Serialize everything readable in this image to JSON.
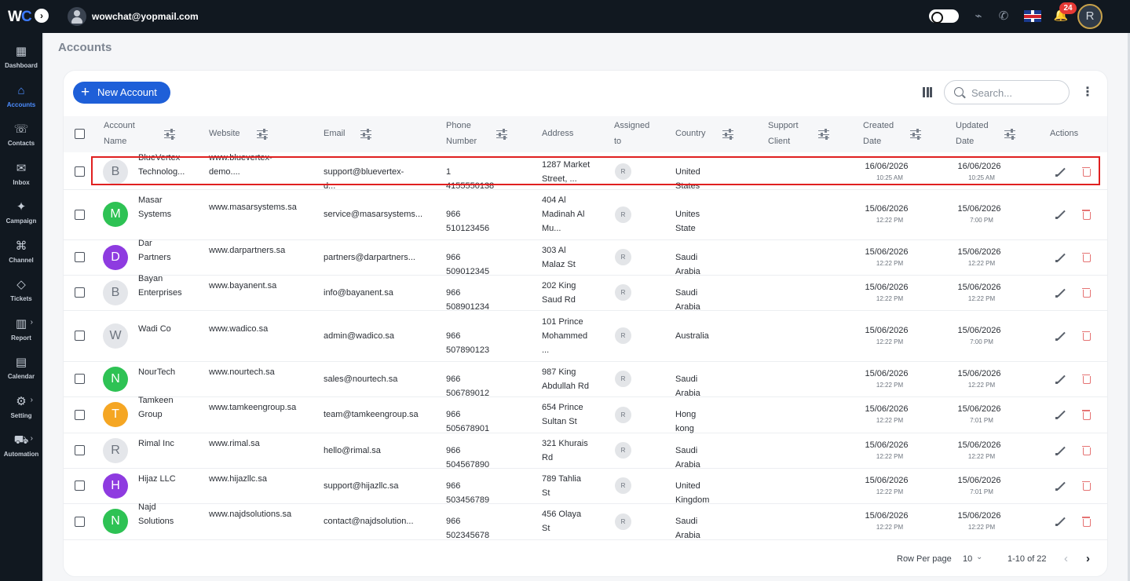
{
  "app": {
    "logo_text": "WC",
    "user_email": "wowchat@yopmail.com",
    "notification_count": "24",
    "user_initial": "R"
  },
  "sidebar": {
    "items": [
      {
        "label": "Dashboard",
        "icon": "dashboard-icon"
      },
      {
        "label": "Accounts",
        "icon": "home-icon",
        "active": true
      },
      {
        "label": "Contacts",
        "icon": "contacts-icon"
      },
      {
        "label": "Inbox",
        "icon": "inbox-icon"
      },
      {
        "label": "Campaign",
        "icon": "campaign-icon"
      },
      {
        "label": "Channel",
        "icon": "channel-icon"
      },
      {
        "label": "Tickets",
        "icon": "ticket-icon"
      },
      {
        "label": "Report",
        "icon": "report-icon"
      },
      {
        "label": "Calendar",
        "icon": "calendar-icon"
      },
      {
        "label": "Setting",
        "icon": "gear-icon"
      },
      {
        "label": "Automation",
        "icon": "automation-icon"
      }
    ]
  },
  "page": {
    "title": "Accounts",
    "new_button": "New Account",
    "search_placeholder": "Search..."
  },
  "table": {
    "headers": {
      "account_name_1": "Account",
      "account_name_2": "Name",
      "website": "Website",
      "email": "Email",
      "phone_1": "Phone",
      "phone_2": "Number",
      "address": "Address",
      "assigned_1": "Assigned",
      "assigned_2": "to",
      "country": "Country",
      "support_1": "Support",
      "support_2": "Client",
      "created_1": "Created",
      "created_2": "Date",
      "updated_1": "Updated",
      "updated_2": "Date",
      "actions": "Actions"
    },
    "rows": [
      {
        "initial": "B",
        "avatar_color": "#e4e6ea",
        "avatar_text_color": "#6d747e",
        "name_1": "BlueVertex",
        "name_2": "Technolog...",
        "website_1": "www.bluevertex-",
        "website_2": "demo....",
        "email": "support@bluevertex-d...",
        "phone": "1 4155550138",
        "address_1": "1287 Market",
        "address_2": "Street, ...",
        "address_3": "",
        "assigned": "R",
        "country": "United States",
        "created_date": "16/06/2026",
        "created_time": "10:25 AM",
        "updated_date": "16/06/2026",
        "updated_time": "10:25 AM"
      },
      {
        "initial": "M",
        "avatar_color": "#2ec254",
        "avatar_text_color": "#ffffff",
        "name_1": "Masar",
        "name_2": "Systems",
        "website_1": "www.masarsystems.sa",
        "website_2": "",
        "email": "service@masarsystems...",
        "phone": "966 510123456",
        "address_1": "404 Al",
        "address_2": "Madinah Al",
        "address_3": "Mu...",
        "assigned": "R",
        "country": "Unites State",
        "created_date": "15/06/2026",
        "created_time": "12:22 PM",
        "updated_date": "15/06/2026",
        "updated_time": "7:00 PM"
      },
      {
        "initial": "D",
        "avatar_color": "#8e3be0",
        "avatar_text_color": "#ffffff",
        "name_1": "Dar",
        "name_2": "Partners",
        "website_1": "www.darpartners.sa",
        "website_2": "",
        "email": "partners@darpartners...",
        "phone": "966 509012345",
        "address_1": "303 Al",
        "address_2": "Malaz St",
        "address_3": "",
        "assigned": "R",
        "country": "Saudi Arabia",
        "created_date": "15/06/2026",
        "created_time": "12:22 PM",
        "updated_date": "15/06/2026",
        "updated_time": "12:22 PM"
      },
      {
        "initial": "B",
        "avatar_color": "#e4e6ea",
        "avatar_text_color": "#6d747e",
        "name_1": "Bayan",
        "name_2": "Enterprises",
        "website_1": "www.bayanent.sa",
        "website_2": "",
        "email": "info@bayanent.sa",
        "phone": "966 508901234",
        "address_1": "202 King",
        "address_2": "Saud Rd",
        "address_3": "",
        "assigned": "R",
        "country": "Saudi Arabia",
        "created_date": "15/06/2026",
        "created_time": "12:22 PM",
        "updated_date": "15/06/2026",
        "updated_time": "12:22 PM"
      },
      {
        "initial": "W",
        "avatar_color": "#e4e6ea",
        "avatar_text_color": "#6d747e",
        "name_1": "Wadi Co",
        "name_2": "",
        "website_1": "www.wadico.sa",
        "website_2": "",
        "email": "admin@wadico.sa",
        "phone": "966 507890123",
        "address_1": "101 Prince",
        "address_2": "Mohammed",
        "address_3": "...",
        "assigned": "R",
        "country": "Australia",
        "created_date": "15/06/2026",
        "created_time": "12:22 PM",
        "updated_date": "15/06/2026",
        "updated_time": "7:00 PM"
      },
      {
        "initial": "N",
        "avatar_color": "#2ec254",
        "avatar_text_color": "#ffffff",
        "name_1": "NourTech",
        "name_2": "",
        "website_1": "www.nourtech.sa",
        "website_2": "",
        "email": "sales@nourtech.sa",
        "phone": "966 506789012",
        "address_1": "987 King",
        "address_2": "Abdullah Rd",
        "address_3": "",
        "assigned": "R",
        "country": "Saudi Arabia",
        "created_date": "15/06/2026",
        "created_time": "12:22 PM",
        "updated_date": "15/06/2026",
        "updated_time": "12:22 PM"
      },
      {
        "initial": "T",
        "avatar_color": "#f5a623",
        "avatar_text_color": "#ffffff",
        "name_1": "Tamkeen",
        "name_2": "Group",
        "website_1": "www.tamkeengroup.sa",
        "website_2": "",
        "email": "team@tamkeengroup.sa",
        "phone": "966 505678901",
        "address_1": "654 Prince",
        "address_2": "Sultan St",
        "address_3": "",
        "assigned": "R",
        "country": "Hong kong",
        "created_date": "15/06/2026",
        "created_time": "12:22 PM",
        "updated_date": "15/06/2026",
        "updated_time": "7:01 PM"
      },
      {
        "initial": "R",
        "avatar_color": "#e4e6ea",
        "avatar_text_color": "#6d747e",
        "name_1": "Rimal Inc",
        "name_2": "",
        "website_1": "www.rimal.sa",
        "website_2": "",
        "email": "hello@rimal.sa",
        "phone": "966 504567890",
        "address_1": "321 Khurais",
        "address_2": "Rd",
        "address_3": "",
        "assigned": "R",
        "country": "Saudi Arabia",
        "created_date": "15/06/2026",
        "created_time": "12:22 PM",
        "updated_date": "15/06/2026",
        "updated_time": "12:22 PM"
      },
      {
        "initial": "H",
        "avatar_color": "#8e3be0",
        "avatar_text_color": "#ffffff",
        "name_1": "Hijaz LLC",
        "name_2": "",
        "website_1": "www.hijazllc.sa",
        "website_2": "",
        "email": "support@hijazllc.sa",
        "phone": "966 503456789",
        "address_1": "789 Tahlia",
        "address_2": "St",
        "address_3": "",
        "assigned": "R",
        "country": "United Kingdom",
        "created_date": "15/06/2026",
        "created_time": "12:22 PM",
        "updated_date": "15/06/2026",
        "updated_time": "7:01 PM"
      },
      {
        "initial": "N",
        "avatar_color": "#2ec254",
        "avatar_text_color": "#ffffff",
        "name_1": "Najd",
        "name_2": "Solutions",
        "website_1": "www.najdsolutions.sa",
        "website_2": "",
        "email": "contact@najdsolution...",
        "phone": "966 502345678",
        "address_1": "456 Olaya",
        "address_2": "St",
        "address_3": "",
        "assigned": "R",
        "country": "Saudi Arabia",
        "created_date": "15/06/2026",
        "created_time": "12:22 PM",
        "updated_date": "15/06/2026",
        "updated_time": "12:22 PM"
      }
    ]
  },
  "pagination": {
    "rows_per_page_label": "Row Per page",
    "rows_per_page_value": "10",
    "range": "1-10 of 22"
  },
  "colors": {
    "accent": "#1e5fd8",
    "sidebar_bg": "#111820",
    "highlight_border": "#e02020"
  }
}
